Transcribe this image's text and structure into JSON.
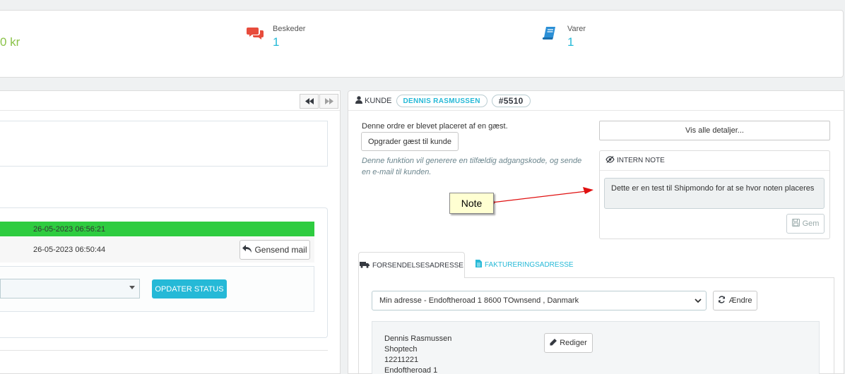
{
  "kpi": {
    "revenue_value": "0 kr",
    "messages": {
      "label": "Beskeder",
      "value": "1",
      "icon": "comments-icon"
    },
    "products": {
      "label": "Varer",
      "value": "1",
      "icon": "book-icon"
    }
  },
  "history": {
    "rows": [
      {
        "date": "26-05-2023 06:56:21",
        "color": "#2ecc40"
      },
      {
        "date": "26-05-2023 06:50:44",
        "action": "Gensend mail"
      }
    ],
    "update_label": "OPDATER STATUS"
  },
  "customer": {
    "section_label": "KUNDE",
    "name": "DENNIS RASMUSSEN",
    "id": "#5510",
    "guest_text": "Denne ordre er blevet placeret af en gæst.",
    "upgrade_label": "Opgrader gæst til kunde",
    "upgrade_info": "Denne funktion vil generere en tilfældig adgangskode, og sende en e-mail til kunden.",
    "details_label": "Vis alle detaljer..."
  },
  "internal_note": {
    "title": "INTERN NOTE",
    "text": "Dette er en test til Shipmondo for at se hvor noten placeres",
    "save_label": "Gem"
  },
  "annotation": {
    "label": "Note"
  },
  "address": {
    "tabs": [
      {
        "label": "FORSENDELSESADRESSE",
        "active": true
      },
      {
        "label": "FAKTURERINGSADRESSE",
        "active": false
      }
    ],
    "selected": "Min adresse - Endoftheroad 1 8600 TOwnsend , Danmark",
    "change_label": "Ændre",
    "edit_label": "Rediger",
    "lines": [
      "Dennis Rasmussen",
      "Shoptech",
      "12211221",
      "Endoftheroad 1"
    ]
  },
  "colors": {
    "accent": "#25b9d7",
    "success": "#2ecc40",
    "revenue": "#8bc34a",
    "messages_icon": "#e74c3c"
  }
}
